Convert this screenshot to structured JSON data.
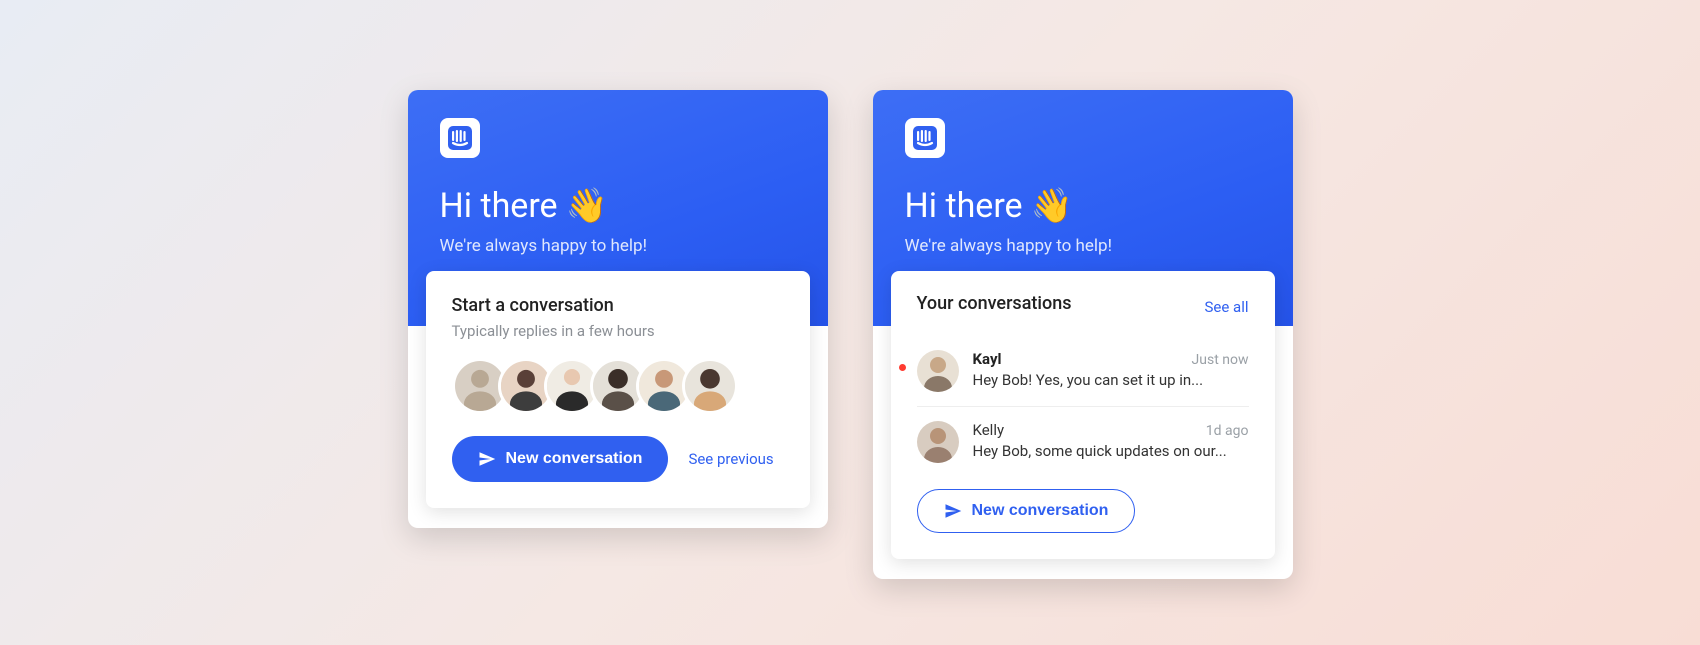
{
  "greeting": "Hi there",
  "wave_emoji": "👋",
  "subtitle": "We're always happy to help!",
  "widget_a": {
    "card_title": "Start a conversation",
    "card_sub": "Typically replies in a few hours",
    "new_conversation_label": "New conversation",
    "see_previous_label": "See previous"
  },
  "widget_b": {
    "section_title": "Your conversations",
    "see_all_label": "See all",
    "new_conversation_label": "New conversation",
    "conversations": [
      {
        "name": "Kayl",
        "time": "Just now",
        "preview": "Hey Bob! Yes, you can set it up in...",
        "unread": true
      },
      {
        "name": "Kelly",
        "time": "1d ago",
        "preview": "Hey Bob, some quick updates on our...",
        "unread": false
      }
    ]
  },
  "colors": {
    "primary": "#3060f0"
  }
}
